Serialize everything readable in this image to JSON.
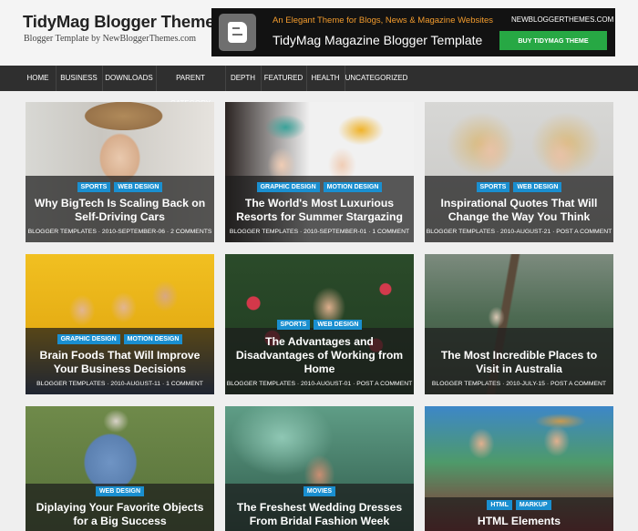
{
  "header": {
    "site_title": "TidyMag Blogger Theme",
    "site_desc": "Blogger Template by NewBloggerThemes.com"
  },
  "banner": {
    "tagline": "An Elegant Theme for Blogs, News & Magazine Websites",
    "title": "TidyMag Magazine Blogger Template",
    "site": "NEWBLOGGERTHEMES.COM",
    "button": "BUY TIDYMAG THEME"
  },
  "nav": {
    "items": [
      "HOME",
      "BUSINESS",
      "DOWNLOADS",
      "PARENT CATEGORY",
      "DEPTH",
      "FEATURED",
      "HEALTH",
      "UNCATEGORIZED"
    ]
  },
  "posts": [
    {
      "tags": [
        "SPORTS",
        "WEB DESIGN"
      ],
      "title": "Why BigTech Is Scaling Back on Self-Driving Cars",
      "author": "BLOGGER TEMPLATES",
      "date": "2010-SEPTEMBER-06",
      "comments": "2 COMMENTS"
    },
    {
      "tags": [
        "GRAPHIC DESIGN",
        "MOTION DESIGN"
      ],
      "title": "The World's Most Luxurious Resorts for Summer Stargazing",
      "author": "BLOGGER TEMPLATES",
      "date": "2010-SEPTEMBER-01",
      "comments": "1 COMMENT"
    },
    {
      "tags": [
        "SPORTS",
        "WEB DESIGN"
      ],
      "title": "Inspirational Quotes That Will Change the Way You Think",
      "author": "BLOGGER TEMPLATES",
      "date": "2010-AUGUST-21",
      "comments": "POST A COMMENT"
    },
    {
      "tags": [
        "GRAPHIC DESIGN",
        "MOTION DESIGN"
      ],
      "title": "Brain Foods That Will Improve Your Business Decisions",
      "author": "BLOGGER TEMPLATES",
      "date": "2010-AUGUST-11",
      "comments": "1 COMMENT"
    },
    {
      "tags": [
        "SPORTS",
        "WEB DESIGN"
      ],
      "title": "The Advantages and Disadvantages of Working from Home",
      "author": "BLOGGER TEMPLATES",
      "date": "2010-AUGUST-01",
      "comments": "POST A COMMENT"
    },
    {
      "tags": [],
      "title": "The Most Incredible Places to Visit in Australia",
      "author": "BLOGGER TEMPLATES",
      "date": "2010-JULY-15",
      "comments": "POST A COMMENT"
    },
    {
      "tags": [
        "WEB DESIGN"
      ],
      "title": "Diplaying Your Favorite Objects for a Big Success",
      "author": "",
      "date": "",
      "comments": ""
    },
    {
      "tags": [
        "MOVIES"
      ],
      "title": "The Freshest Wedding Dresses From Bridal Fashion Week",
      "author": "",
      "date": "",
      "comments": ""
    },
    {
      "tags": [
        "HTML",
        "MARKUP"
      ],
      "title": "HTML Elements",
      "author": "",
      "date": "",
      "comments": ""
    }
  ]
}
